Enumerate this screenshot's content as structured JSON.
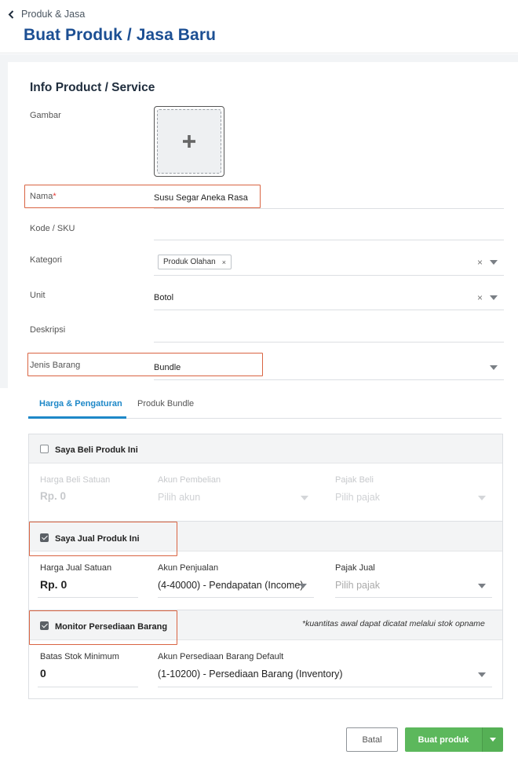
{
  "header": {
    "breadcrumb": "Produk & Jasa",
    "title": "Buat Produk / Jasa Baru"
  },
  "info": {
    "section_title": "Info Product / Service",
    "image_label": "Gambar",
    "name_label": "Nama",
    "name_required": "*",
    "name_value": "Susu Segar Aneka Rasa",
    "sku_label": "Kode / SKU",
    "sku_value": "",
    "category_label": "Kategori",
    "category_tag": "Produk Olahan",
    "unit_label": "Unit",
    "unit_value": "Botol",
    "description_label": "Deskripsi",
    "description_value": "",
    "type_label": "Jenis Barang",
    "type_value": "Bundle",
    "clear_glyph": "×"
  },
  "tabs": [
    {
      "label": "Harga & Pengaturan",
      "active": true
    },
    {
      "label": "Produk Bundle",
      "active": false
    }
  ],
  "buy": {
    "checkbox_label": "Saya Beli Produk Ini",
    "checked": false,
    "price_label": "Harga Beli Satuan",
    "price_value": "Rp. 0",
    "account_label": "Akun Pembelian",
    "account_placeholder": "Pilih akun",
    "tax_label": "Pajak Beli",
    "tax_placeholder": "Pilih pajak"
  },
  "sell": {
    "checkbox_label": "Saya Jual Produk Ini",
    "checked": true,
    "price_label": "Harga Jual Satuan",
    "price_value": "Rp. 0",
    "account_label": "Akun Penjualan",
    "account_value": "(4-40000) - Pendapatan (Income)",
    "tax_label": "Pajak Jual",
    "tax_placeholder": "Pilih pajak"
  },
  "inventory": {
    "checkbox_label": "Monitor Persediaan Barang",
    "checked": true,
    "note": "*kuantitas awal dapat dicatat melalui stok opname",
    "min_stock_label": "Batas Stok Minimum",
    "min_stock_value": "0",
    "account_label": "Akun Persediaan Barang Default",
    "account_value": "(1-10200) - Persediaan Barang (Inventory)"
  },
  "actions": {
    "cancel_label": "Batal",
    "create_label": "Buat produk"
  },
  "colors": {
    "title_blue": "#1c4f93",
    "tab_blue": "#1e88c8",
    "highlight": "#d96442",
    "create_green": "#5cb85c"
  },
  "icons": {
    "back": "chevron-left-icon",
    "add_image": "plus-icon",
    "dropdown": "caret-down-icon",
    "clear": "close-icon"
  }
}
